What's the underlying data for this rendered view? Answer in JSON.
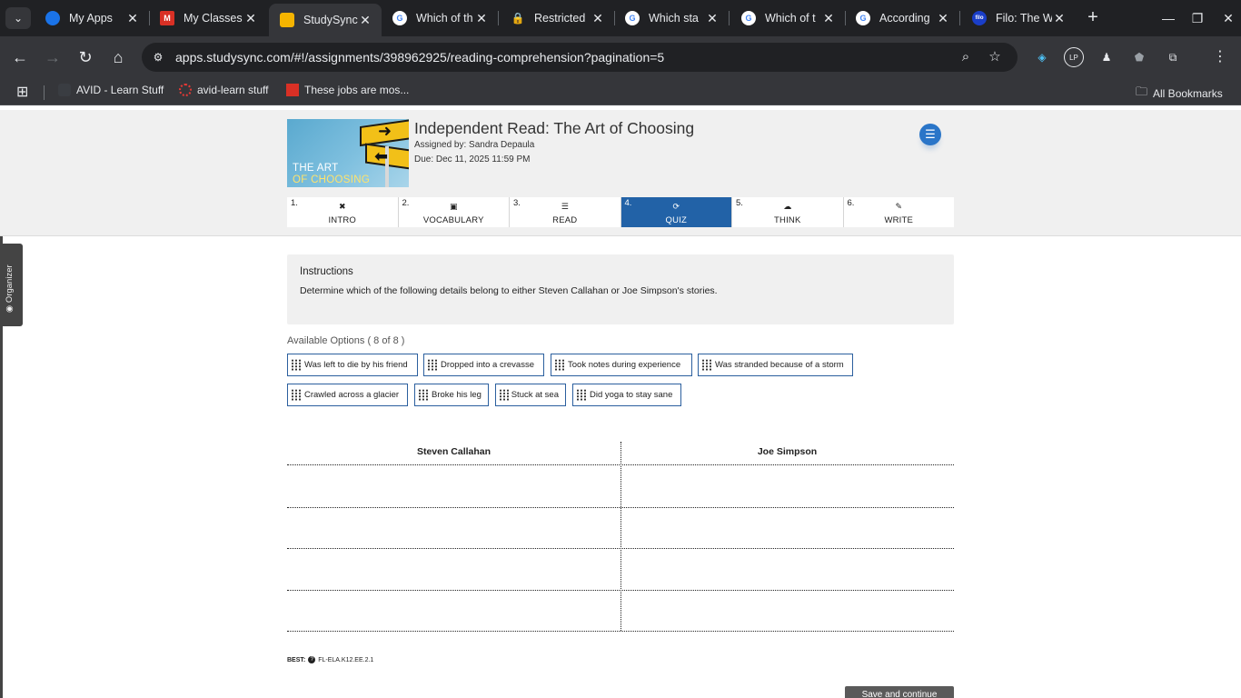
{
  "browser": {
    "tabs": [
      {
        "title": "My Apps",
        "favicon_color": "#1a73e8",
        "active": false
      },
      {
        "title": "My Classes",
        "favicon_color": "#d93025",
        "active": false
      },
      {
        "title": "StudySync",
        "favicon_color": "#f5b400",
        "active": true
      },
      {
        "title": "Which of th",
        "favicon_color": "#ffffff",
        "active": false
      },
      {
        "title": "Restricted",
        "favicon_color": "#4fc3f7",
        "active": false
      },
      {
        "title": "Which sta",
        "favicon_color": "#ffffff",
        "active": false
      },
      {
        "title": "Which of t",
        "favicon_color": "#ffffff",
        "active": false
      },
      {
        "title": "According",
        "favicon_color": "#ffffff",
        "active": false
      },
      {
        "title": "Filo: The W",
        "favicon_color": "#1a3ec8",
        "active": false
      }
    ],
    "filo_favicon_text": "filo",
    "url": "apps.studysync.com/#!/assignments/398962925/reading-comprehension?pagination=5",
    "bookmarks": [
      {
        "label": "AVID - Learn Stuff"
      },
      {
        "label": "avid-learn stuff"
      },
      {
        "label": "These jobs are mos..."
      }
    ],
    "all_bookmarks": "All Bookmarks"
  },
  "assignment": {
    "thumbnail_line1": "THE ART",
    "thumbnail_line2": "OF CHOOSING",
    "title": "Independent Read: The Art of Choosing",
    "assigned_by": "Assigned by: Sandra Depaula",
    "due": "Due: Dec 11, 2025 11:59 PM"
  },
  "steps": [
    {
      "num": "1.",
      "label": "INTRO",
      "icon": "✖"
    },
    {
      "num": "2.",
      "label": "VOCABULARY",
      "icon": "▣"
    },
    {
      "num": "3.",
      "label": "READ",
      "icon": "☰"
    },
    {
      "num": "4.",
      "label": "QUIZ",
      "icon": "⟳",
      "active": true
    },
    {
      "num": "5.",
      "label": "THINK",
      "icon": "☁"
    },
    {
      "num": "6.",
      "label": "WRITE",
      "icon": "✎"
    }
  ],
  "organizer": "Organizer",
  "instructions": {
    "title": "Instructions",
    "text": "Determine which of the following details belong to either Steven Callahan or Joe Simpson's stories."
  },
  "available_options": "Available Options ( 8 of 8 )",
  "options": [
    "Was left to die by his friend",
    "Dropped into a crevasse",
    "Took notes during experience",
    "Was stranded because of a storm",
    "Crawled across a glacier",
    "Broke his leg",
    "Stuck at sea",
    "Did yoga to stay sane"
  ],
  "columns": [
    "Steven Callahan",
    "Joe Simpson"
  ],
  "standard": {
    "label": "BEST:",
    "code": "FL-ELA.K12.EE.2.1"
  },
  "save_button": "Save and continue",
  "colors": {
    "accent": "#2262a7",
    "chip_border": "#2b5f9e",
    "menu_button": "#2a75c8"
  }
}
